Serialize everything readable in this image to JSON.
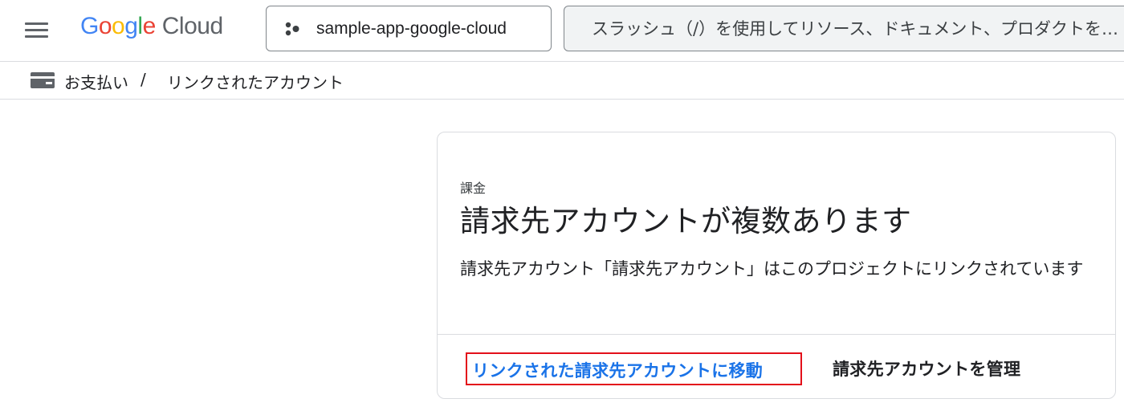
{
  "header": {
    "logo": {
      "google_letters": [
        "G",
        "o",
        "o",
        "g",
        "l",
        "e"
      ],
      "product": "Cloud"
    },
    "project_picker": {
      "name": "sample-app-google-cloud"
    },
    "search": {
      "placeholder": "スラッシュ（/）を使用してリソース、ドキュメント、プロダクトを検索"
    }
  },
  "breadcrumb": {
    "items": [
      "お支払い",
      "リンクされたアカウント"
    ],
    "separator": "/"
  },
  "card": {
    "eyebrow": "課金",
    "title": "請求先アカウントが複数あります",
    "body": "請求先アカウント「請求先アカウント」はこのプロジェクトにリンクされています",
    "primary_action": "リンクされた請求先アカウントに移動",
    "secondary_action": "請求先アカウントを管理"
  },
  "colors": {
    "link": "#1a73e8",
    "highlight_border": "#e3101a",
    "divider": "#dadce0"
  }
}
